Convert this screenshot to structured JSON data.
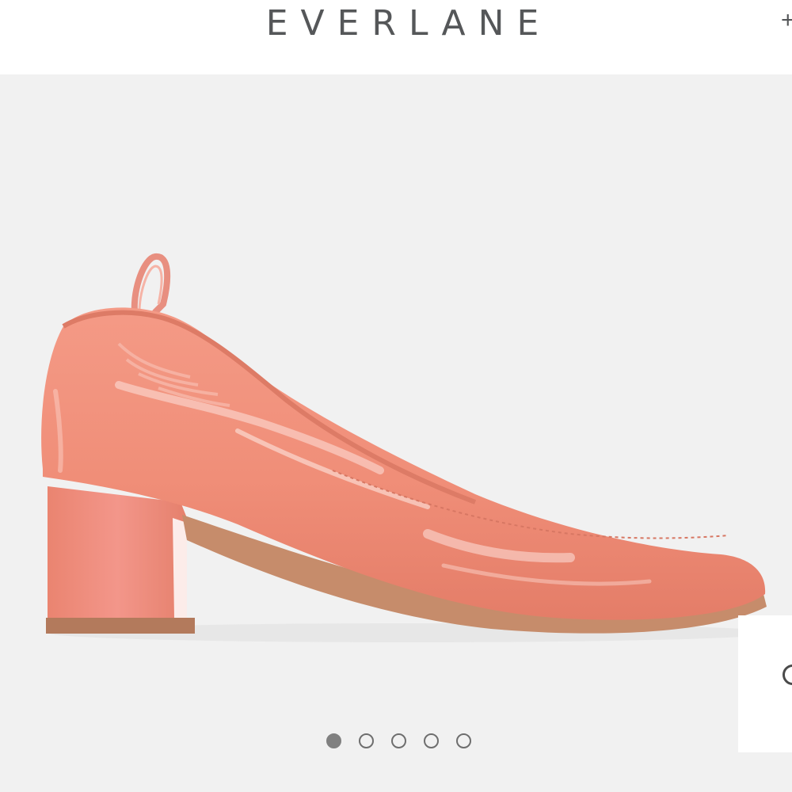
{
  "header": {
    "brand": "EVERLANE",
    "right_icon": "plus-icon"
  },
  "gallery": {
    "product_image_icon": "patent-leather-pump-photo",
    "slide_count": 5,
    "active_slide": 1
  },
  "side_widget": {
    "icon": "chat-icon"
  },
  "colors": {
    "shoe": "#f1907b",
    "background": "#f1f1f1",
    "logo": "#555759"
  }
}
